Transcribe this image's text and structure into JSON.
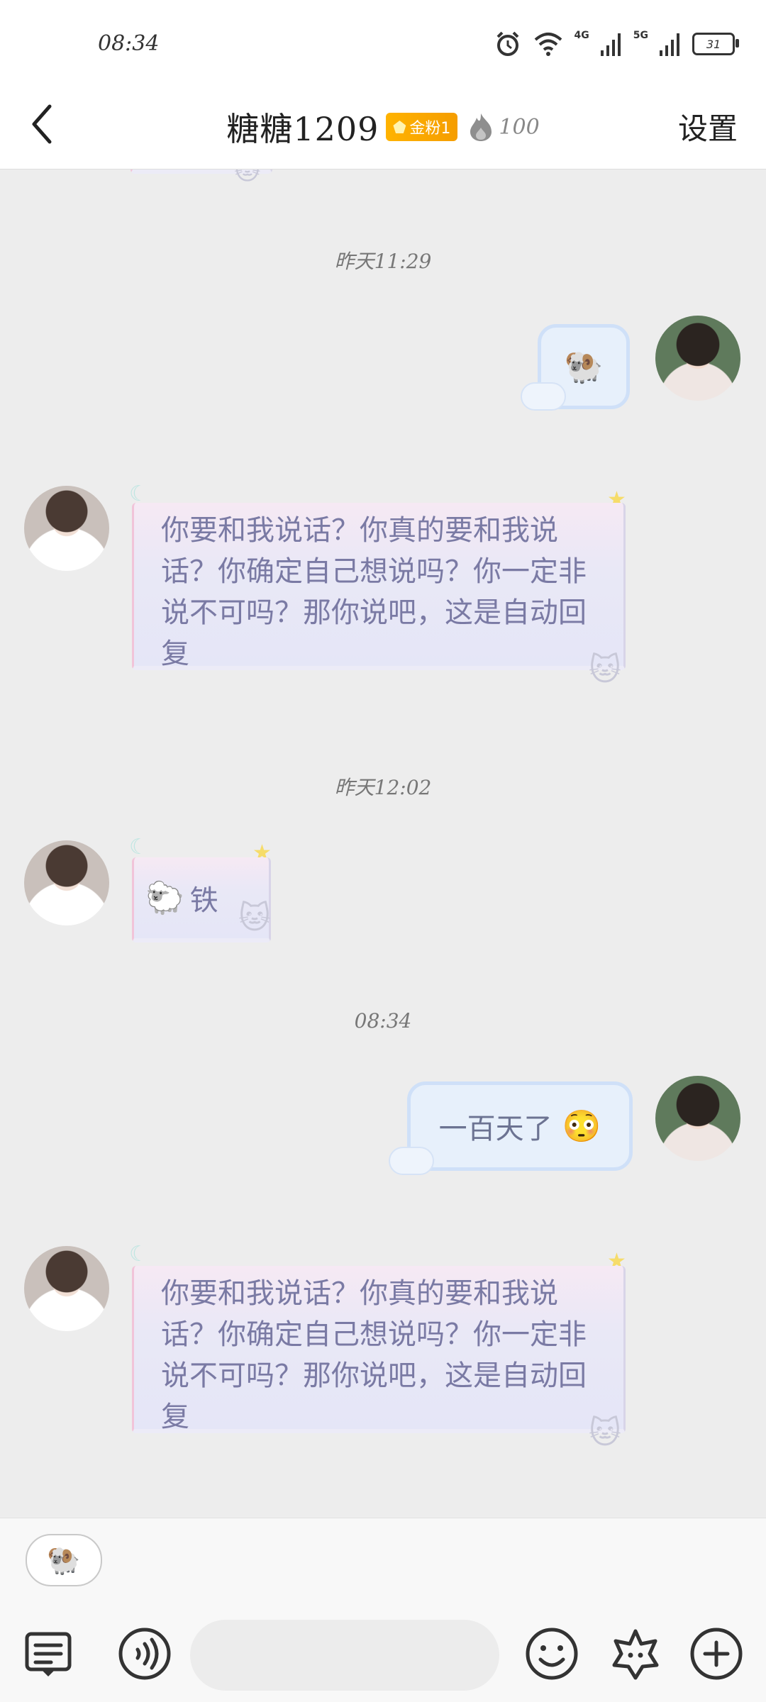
{
  "status_bar": {
    "time": "08:34",
    "signal_1_label": "4G",
    "signal_2_label": "5G",
    "battery_level": "31"
  },
  "header": {
    "title": "糖糖1209",
    "fan_badge": "金粉1",
    "fire_count": "100",
    "settings_label": "设置"
  },
  "messages": [
    {
      "type": "timestamp",
      "text": "昨天11:29"
    },
    {
      "type": "outgoing",
      "content_icon": "sheep-emoji",
      "content": "🐏"
    },
    {
      "type": "incoming",
      "text": "你要和我说话？你真的要和我说话？你确定自己想说吗？你一定非说不可吗？那你说吧，这是自动回复"
    },
    {
      "type": "timestamp",
      "text": "昨天12:02"
    },
    {
      "type": "incoming",
      "content_icon": "sheep-emoji",
      "content": "🐑",
      "text": "铁"
    },
    {
      "type": "timestamp",
      "text": "08:34"
    },
    {
      "type": "outgoing",
      "text": "一百天了",
      "content_icon": "blushing-face-emoji",
      "content": "😳"
    },
    {
      "type": "incoming",
      "text": "你要和我说话？你真的要和我说话？你确定自己想说吗？你一定非说不可吗？那你说吧，这是自动回复"
    }
  ],
  "quick_reply": {
    "icon": "sheep-emoji",
    "content": "🐏"
  },
  "input": {
    "placeholder": "",
    "value": ""
  },
  "toolbar_icons": [
    "keyboard-menu-icon",
    "voice-icon",
    "emoji-face-icon",
    "sticker-icon",
    "plus-icon"
  ],
  "colors": {
    "background": "#ededed",
    "fan_badge": "#ffb300",
    "incoming_text": "#7a7aa4",
    "outgoing_bubble_border": "#cfe0f8"
  }
}
